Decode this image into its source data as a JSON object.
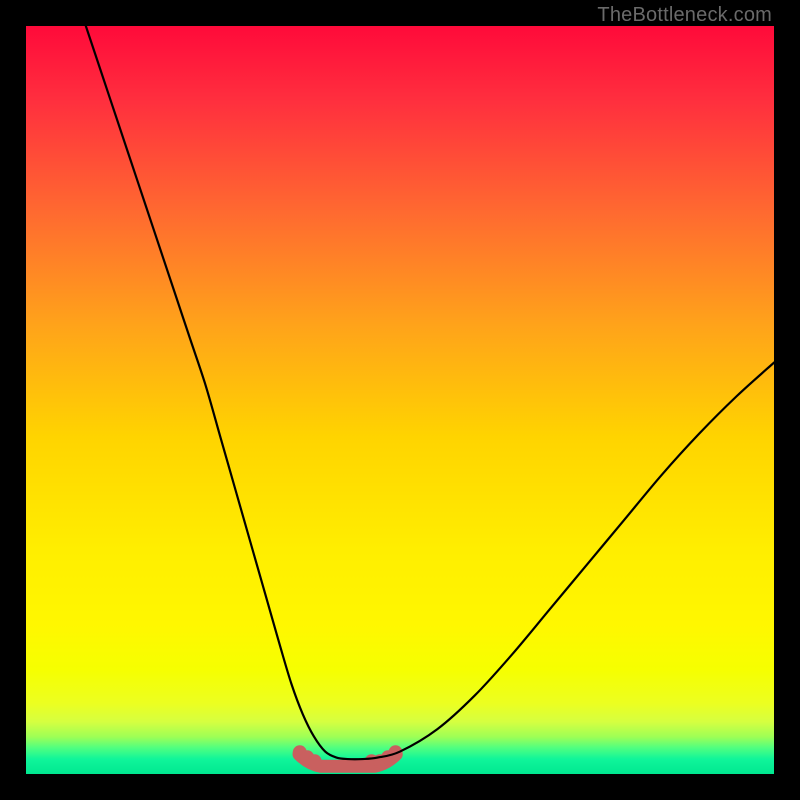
{
  "watermark": "TheBottleneck.com",
  "colors": {
    "black": "#000000",
    "curve": "#000000",
    "optimal_band": "#c9605f",
    "optimal_dot": "#c9605f",
    "gradient_stops": [
      {
        "offset": 0.0,
        "color": "#ff0a3a"
      },
      {
        "offset": 0.1,
        "color": "#ff2f3e"
      },
      {
        "offset": 0.25,
        "color": "#ff6a30"
      },
      {
        "offset": 0.4,
        "color": "#ffa31a"
      },
      {
        "offset": 0.55,
        "color": "#ffd400"
      },
      {
        "offset": 0.7,
        "color": "#ffee00"
      },
      {
        "offset": 0.8,
        "color": "#fff700"
      },
      {
        "offset": 0.86,
        "color": "#f6ff00"
      },
      {
        "offset": 0.905,
        "color": "#ecff20"
      },
      {
        "offset": 0.93,
        "color": "#d6ff40"
      },
      {
        "offset": 0.95,
        "color": "#9fff55"
      },
      {
        "offset": 0.965,
        "color": "#50ff80"
      },
      {
        "offset": 0.98,
        "color": "#10f59a"
      },
      {
        "offset": 1.0,
        "color": "#00e890"
      }
    ]
  },
  "chart_data": {
    "type": "line",
    "title": "",
    "xlabel": "",
    "ylabel": "",
    "xlim": [
      0,
      100
    ],
    "ylim": [
      0,
      100
    ],
    "series": [
      {
        "name": "bottleneck-curve",
        "x": [
          8,
          10,
          12,
          14,
          16,
          18,
          20,
          22,
          24,
          26,
          28,
          30,
          32,
          34,
          35.5,
          37,
          38.5,
          40,
          41.5,
          43,
          45,
          47,
          50,
          55,
          60,
          65,
          70,
          75,
          80,
          85,
          90,
          95,
          100
        ],
        "values": [
          100,
          94,
          88,
          82,
          76,
          70,
          64,
          58,
          52,
          45,
          38,
          31,
          24,
          17,
          12,
          8,
          5,
          3,
          2.2,
          2,
          2,
          2.2,
          3,
          6,
          10.5,
          16,
          22,
          28,
          34,
          40,
          45.5,
          50.5,
          55
        ]
      }
    ],
    "optimal_region": {
      "x_start": 36.5,
      "x_end": 49.5,
      "y": 2.1
    },
    "optimal_dots_x": [
      36.6,
      37.6,
      38.6,
      46.2,
      47.3,
      48.4,
      49.4
    ]
  }
}
